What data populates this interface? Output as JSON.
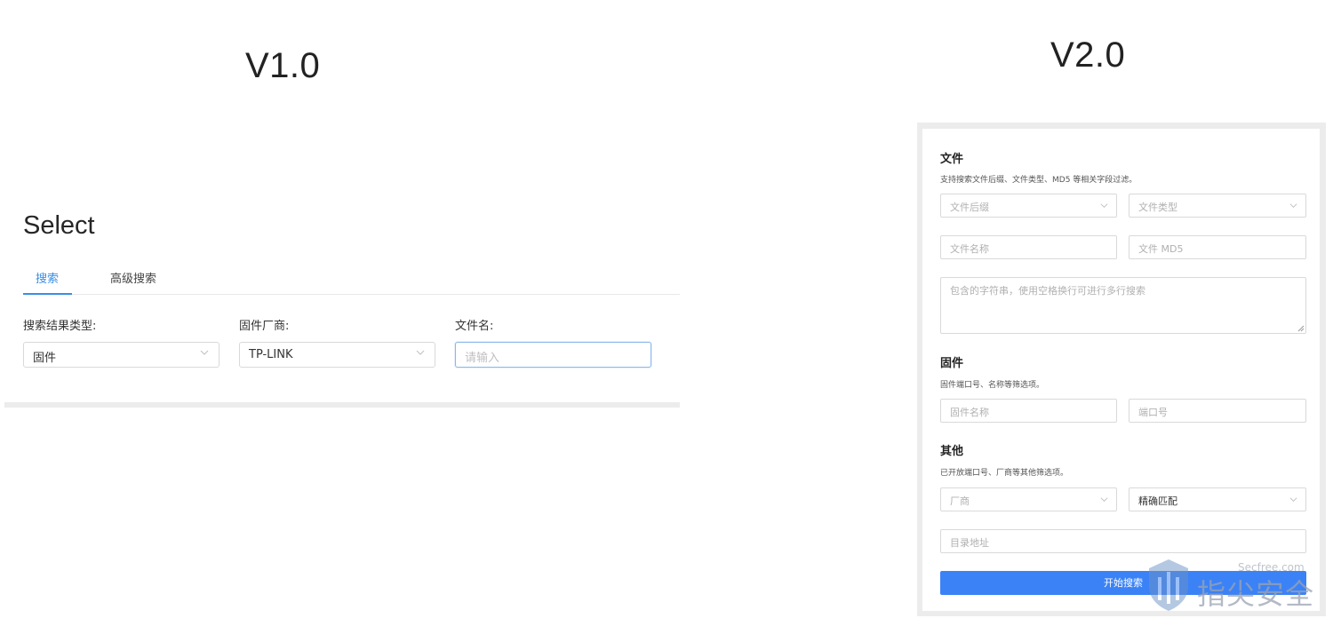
{
  "versions": {
    "v1": "V1.0",
    "v2": "V2.0"
  },
  "v1": {
    "heading": "Select",
    "tabs": [
      {
        "label": "搜索",
        "active": true
      },
      {
        "label": "高级搜索",
        "active": false
      }
    ],
    "fields": [
      {
        "label": "搜索结果类型:",
        "value": "固件"
      },
      {
        "label": "固件厂商:",
        "value": "TP-LINK"
      },
      {
        "label": "文件名:",
        "placeholder": "请输入"
      }
    ]
  },
  "v2": {
    "sections": {
      "file": {
        "title": "文件",
        "desc": "支持搜索文件后缀、文件类型、MD5 等相关字段过滤。",
        "suffix_placeholder": "文件后缀",
        "type_placeholder": "文件类型",
        "name_placeholder": "文件名称",
        "md5_placeholder": "文件 MD5",
        "strings_placeholder": "包含的字符串，使用空格换行可进行多行搜索"
      },
      "firmware": {
        "title": "固件",
        "desc": "固件端口号、名称等筛选项。",
        "name_placeholder": "固件名称",
        "port_placeholder": "端口号"
      },
      "other": {
        "title": "其他",
        "desc": "已开放端口号、厂商等其他筛选项。",
        "vendor_placeholder": "厂商",
        "match_value": "精确匹配",
        "dir_placeholder": "目录地址"
      }
    },
    "submit_label": "开始搜索"
  },
  "watermark": {
    "text": "指尖安全",
    "url": "Secfree.com"
  },
  "colors": {
    "accent": "#3a8ee6",
    "button": "#3b82f6",
    "border": "#d9d9d9"
  }
}
